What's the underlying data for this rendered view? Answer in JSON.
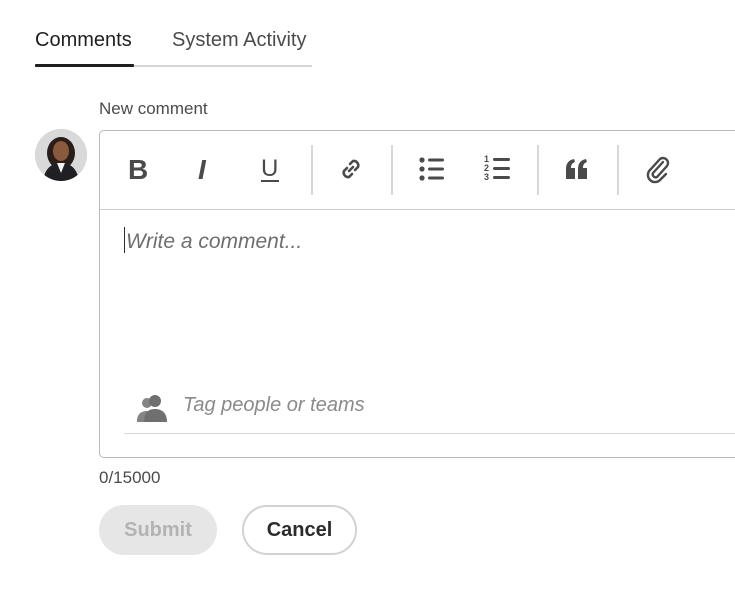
{
  "tabs": [
    {
      "label": "Comments",
      "active": true
    },
    {
      "label": "System Activity",
      "active": false
    }
  ],
  "composer": {
    "label": "New comment",
    "placeholder": "Write a comment...",
    "tag_placeholder": "Tag people or teams",
    "char_count": "0/15000",
    "toolbar": [
      {
        "name": "bold",
        "glyph": "B"
      },
      {
        "name": "italic",
        "glyph": "I"
      },
      {
        "name": "underline",
        "glyph": "U"
      },
      {
        "name": "link",
        "icon": "link-icon"
      },
      {
        "name": "bulleted-list",
        "icon": "bulleted-list-icon"
      },
      {
        "name": "numbered-list",
        "icon": "numbered-list-icon"
      },
      {
        "name": "quote",
        "icon": "quote-icon"
      },
      {
        "name": "attach",
        "icon": "paperclip-icon"
      }
    ]
  },
  "buttons": {
    "submit": "Submit",
    "cancel": "Cancel"
  },
  "colors": {
    "text": "#2c2c2c",
    "tab_indicator": "#1f1f1f",
    "submit_disabled_bg": "#e6e6e6",
    "submit_disabled_text": "#b3b3b3"
  }
}
